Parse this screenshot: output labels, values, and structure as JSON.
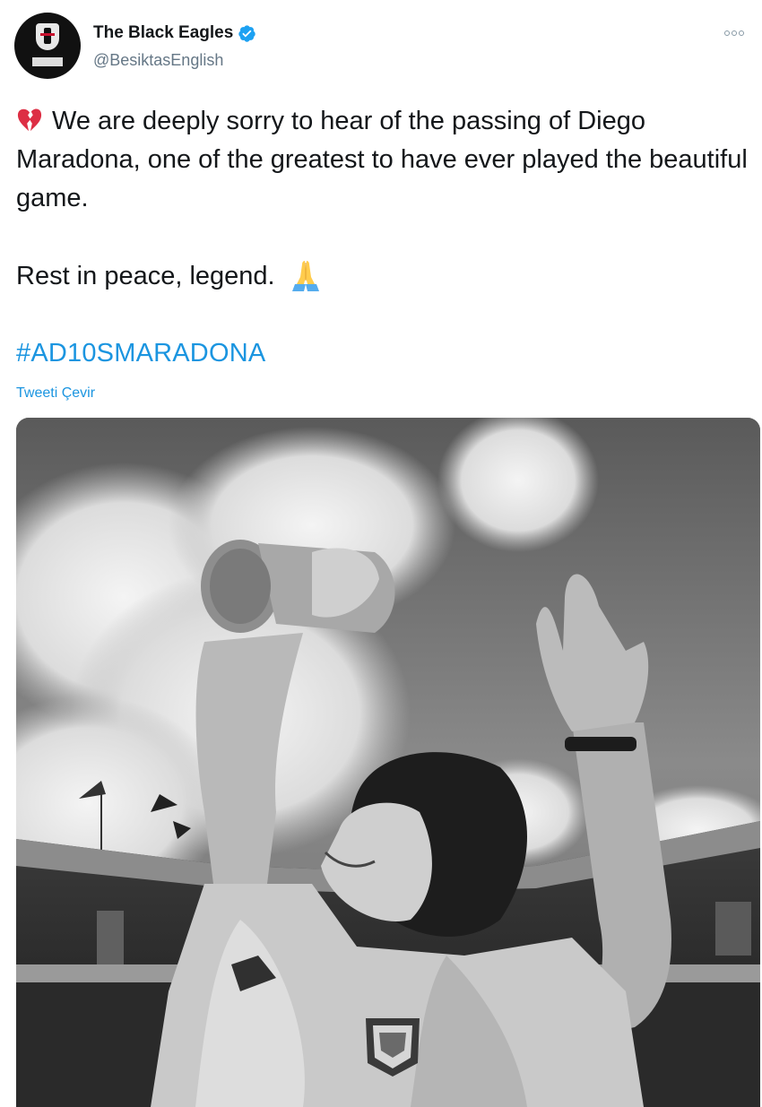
{
  "author": {
    "display_name": "The Black Eagles",
    "handle": "@BesiktasEnglish",
    "verified": true,
    "avatar_icon": "besiktas-crest-icon"
  },
  "menu": {
    "icon": "more-options-icon"
  },
  "tweet": {
    "text_line1": "We are deeply sorry to hear of the passing of Diego Maradona, one of the greatest to have ever played the beautiful game.",
    "text_line2": "Rest in peace, legend.",
    "emoji_start": "broken-heart-icon",
    "emoji_end": "folded-hands-icon",
    "hashtag": "#AD10SMARADONA",
    "translate_label": "Tweeti Çevir"
  },
  "media": {
    "type": "photo",
    "style": "black-and-white"
  },
  "colors": {
    "link": "#1b95e0",
    "secondary_text": "#657786",
    "verified_badge": "#1da1f2",
    "broken_heart": "#e0245e",
    "folded_hands": "#ffcc4d"
  }
}
